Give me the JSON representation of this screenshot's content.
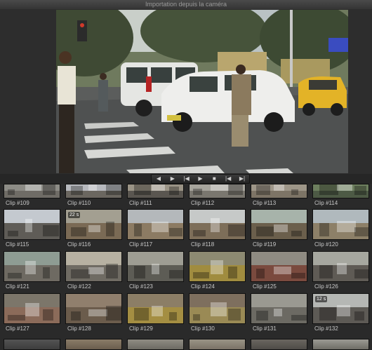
{
  "window": {
    "title": "Importation depuis la caméra"
  },
  "transport": {
    "buttons": [
      {
        "name": "previous-clip-button",
        "icon": "triangle-left-icon",
        "glyph": "◀"
      },
      {
        "name": "next-clip-button",
        "icon": "triangle-right-icon",
        "glyph": "▶"
      },
      {
        "name": "rewind-button",
        "icon": "skip-back-icon",
        "glyph": "|◀"
      },
      {
        "name": "play-button",
        "icon": "play-icon",
        "glyph": "▶"
      },
      {
        "name": "stop-button",
        "icon": "stop-icon",
        "glyph": "■"
      },
      {
        "name": "jump-start-button",
        "icon": "jump-start-icon",
        "glyph": "|◀"
      },
      {
        "name": "jump-end-button",
        "icon": "jump-end-icon",
        "glyph": "▶|"
      }
    ]
  },
  "clips": {
    "row1": [
      {
        "label": "Clip #109",
        "palette": [
          "#8d8c86",
          "#6f6c66"
        ]
      },
      {
        "label": "Clip #110",
        "palette": [
          "#b7b9be",
          "#6b6760"
        ]
      },
      {
        "label": "Clip #111",
        "palette": [
          "#9b9486",
          "#5a5650"
        ]
      },
      {
        "label": "Clip #112",
        "palette": [
          "#a6a49c",
          "#7a776f"
        ]
      },
      {
        "label": "Clip #113",
        "palette": [
          "#9e9688",
          "#7d7466"
        ]
      },
      {
        "label": "Clip #114",
        "palette": [
          "#6d7f5e",
          "#4d5a45"
        ]
      }
    ],
    "row2": [
      {
        "label": "Clip #115",
        "duration": "",
        "palette": [
          "#c4c9cf",
          "#5f5c57"
        ]
      },
      {
        "label": "Clip #116",
        "duration": "22 s",
        "palette": [
          "#a39f91",
          "#7a6a55"
        ]
      },
      {
        "label": "Clip #117",
        "duration": "",
        "palette": [
          "#b4b8bb",
          "#8c7b63"
        ]
      },
      {
        "label": "Clip #118",
        "duration": "",
        "palette": [
          "#c6c9c8",
          "#7d6e59"
        ]
      },
      {
        "label": "Clip #119",
        "duration": "",
        "palette": [
          "#a7b3aa",
          "#6b5f4c"
        ]
      },
      {
        "label": "Clip #120",
        "duration": "",
        "palette": [
          "#b0b9bd",
          "#8d8068"
        ]
      }
    ],
    "row3": [
      {
        "label": "Clip #121",
        "duration": "",
        "palette": [
          "#8e9c93",
          "#6e6a62"
        ]
      },
      {
        "label": "Clip #122",
        "duration": "",
        "palette": [
          "#b7b1a2",
          "#6f6b63"
        ]
      },
      {
        "label": "Clip #123",
        "duration": "",
        "palette": [
          "#9e9d93",
          "#5d5c55"
        ]
      },
      {
        "label": "Clip #124",
        "duration": "",
        "palette": [
          "#8d8a72",
          "#a08c3f"
        ]
      },
      {
        "label": "Clip #125",
        "duration": "",
        "palette": [
          "#8f8b82",
          "#7a4a3e"
        ]
      },
      {
        "label": "Clip #126",
        "duration": "",
        "palette": [
          "#a6a79f",
          "#5f5b55"
        ]
      }
    ],
    "row4": [
      {
        "label": "Clip #127",
        "duration": "",
        "palette": [
          "#7c766a",
          "#8b6b5a"
        ]
      },
      {
        "label": "Clip #128",
        "duration": "",
        "palette": [
          "#907f6d",
          "#6b5c4c"
        ]
      },
      {
        "label": "Clip #129",
        "duration": "",
        "palette": [
          "#8c7e66",
          "#a48e42"
        ]
      },
      {
        "label": "Clip #130",
        "duration": "",
        "palette": [
          "#7e6f5e",
          "#9a8a55"
        ]
      },
      {
        "label": "Clip #131",
        "duration": "",
        "palette": [
          "#9a9991",
          "#6c6a63"
        ]
      },
      {
        "label": "Clip #132",
        "duration": "12 s",
        "palette": [
          "#b5b7b4",
          "#5d5a55"
        ]
      }
    ],
    "row5": [
      {
        "palette": [
          "#545454",
          "#3d3d3d"
        ]
      },
      {
        "palette": [
          "#8a7c68",
          "#6a5d4d"
        ]
      },
      {
        "palette": [
          "#8f8c83",
          "#6c6a63"
        ]
      },
      {
        "palette": [
          "#9a9486",
          "#7a7266"
        ]
      },
      {
        "palette": [
          "#6a6660",
          "#4e4b47"
        ]
      },
      {
        "palette": [
          "#9b9a93",
          "#6f6d66"
        ]
      }
    ]
  }
}
